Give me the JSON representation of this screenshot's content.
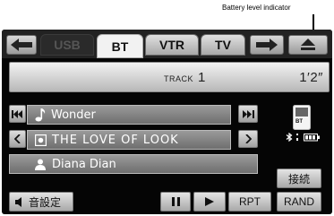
{
  "callout": {
    "label": "Battery level indicator"
  },
  "tabs": {
    "usb": "USB",
    "bt": "BT",
    "vtr": "VTR",
    "tv": "TV"
  },
  "track": {
    "label": "TRACK",
    "number": "1",
    "time": "1′2″"
  },
  "rows": {
    "title": "Wonder",
    "album": "THE LOVE OF LOOK",
    "artist": "Diana Dian"
  },
  "status": {
    "bt_label": "BT"
  },
  "connect_label": "接続",
  "bottom": {
    "sound_settings": "音設定",
    "rpt": "RPT",
    "rand": "RAND"
  },
  "icons": {
    "back": "back-arrow-icon",
    "forward": "forward-arrow-icon",
    "eject": "eject-icon",
    "prev_track": "previous-track-icon",
    "next_track": "next-track-icon",
    "note": "music-note-icon",
    "album": "album-icon",
    "artist": "artist-icon",
    "phone": "phone-icon",
    "battery": "battery-icon",
    "bluetooth": "bluetooth-icon",
    "speaker": "speaker-icon",
    "pause": "pause-icon",
    "play": "play-icon"
  }
}
